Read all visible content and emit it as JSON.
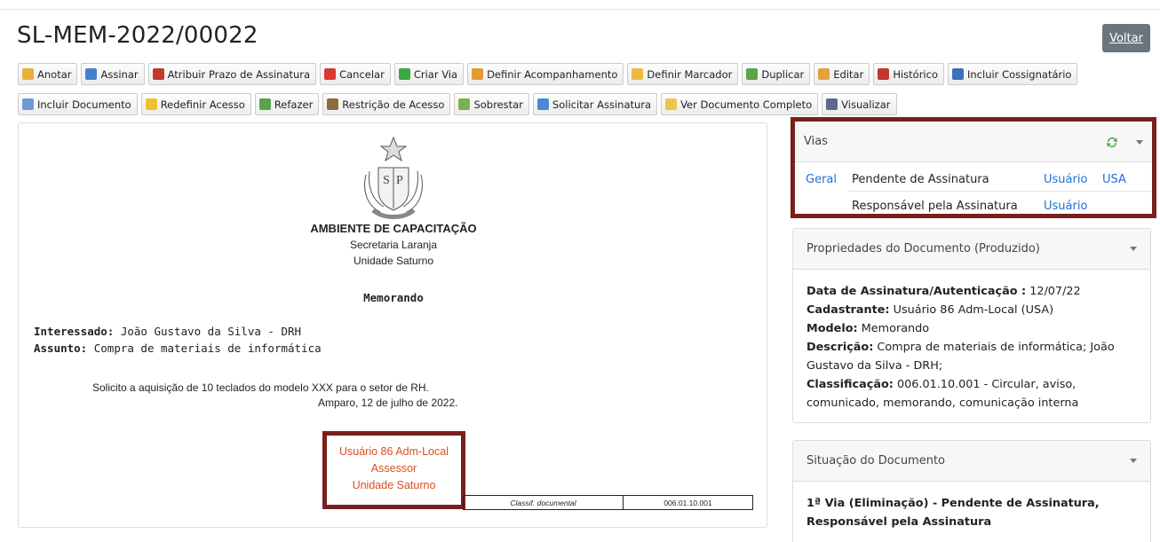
{
  "page": {
    "title": "SL-MEM-2022/00022",
    "back_label": "Voltar"
  },
  "toolbar1": [
    {
      "label": "Anotar",
      "icon": "annotate-icon",
      "color": "#e7b23a"
    },
    {
      "label": "Assinar",
      "icon": "sign-icon",
      "color": "#4a7fd0"
    },
    {
      "label": "Atribuir Prazo de Assinatura",
      "icon": "calendar-icon",
      "color": "#c0392b"
    },
    {
      "label": "Cancelar",
      "icon": "cancel-icon",
      "color": "#d93a2f"
    },
    {
      "label": "Criar Via",
      "icon": "add-icon",
      "color": "#3aa845"
    },
    {
      "label": "Definir Acompanhamento",
      "icon": "user-folder-icon",
      "color": "#e39a2e"
    },
    {
      "label": "Definir Marcador",
      "icon": "folder-icon",
      "color": "#efb93f"
    },
    {
      "label": "Duplicar",
      "icon": "duplicate-icon",
      "color": "#5aa34a"
    },
    {
      "label": "Editar",
      "icon": "pencil-icon",
      "color": "#e1a33c"
    },
    {
      "label": "Histórico",
      "icon": "history-icon",
      "color": "#c0392b"
    },
    {
      "label": "Incluir Cossignatário",
      "icon": "users-icon",
      "color": "#3e70b8"
    }
  ],
  "toolbar2": [
    {
      "label": "Incluir Documento",
      "icon": "document-add-icon",
      "color": "#6c9ad6"
    },
    {
      "label": "Redefinir Acesso",
      "icon": "shield-icon",
      "color": "#f0c030"
    },
    {
      "label": "Refazer",
      "icon": "redo-icon",
      "color": "#5aa34a"
    },
    {
      "label": "Restrição de Acesso",
      "icon": "lock-users-icon",
      "color": "#8a6d3b"
    },
    {
      "label": "Sobrestar",
      "icon": "stack-icon",
      "color": "#7fb04f"
    },
    {
      "label": "Solicitar Assinatura",
      "icon": "request-sign-icon",
      "color": "#4a8ad0"
    },
    {
      "label": "Ver Documento Completo",
      "icon": "folder-open-icon",
      "color": "#f0c44a"
    },
    {
      "label": "Visualizar",
      "icon": "eye-icon",
      "color": "#5a6b8c"
    }
  ],
  "document": {
    "org": "AMBIENTE DE CAPACITAÇÃO",
    "secretaria": "Secretaria Laranja",
    "unidade": "Unidade Saturno",
    "type": "Memorando",
    "interessado_label": "Interessado:",
    "interessado": "João Gustavo da Silva - DRH",
    "assunto_label": "Assunto:",
    "assunto": "Compra de materiais de informática",
    "body": "Solicito a aquisição de 10 teclados do modelo XXX para o setor de RH.",
    "date": "Amparo, 12 de julho de 2022.",
    "signer_name": "Usuário 86 Adm-Local",
    "signer_role": "Assessor",
    "signer_unit": "Unidade Saturno",
    "classif_label": "Classif. documental",
    "classif_value": "006.01.10.001"
  },
  "vias": {
    "title": "Vias",
    "rows": [
      {
        "via": "Geral",
        "status": "Pendente de Assinatura",
        "who": "Usuário",
        "org": "USA"
      },
      {
        "via": "",
        "status": "Responsável pela Assinatura",
        "who": "Usuário",
        "org": ""
      }
    ]
  },
  "propriedades": {
    "title": "Propriedades do Documento (Produzido)",
    "data_label": "Data de Assinatura/Autenticação :",
    "data_value": "12/07/22",
    "cadastrante_label": "Cadastrante:",
    "cadastrante_value": "Usuário 86 Adm-Local (USA)",
    "modelo_label": "Modelo:",
    "modelo_value": "Memorando",
    "descricao_label": "Descrição:",
    "descricao_value": "Compra de materiais de informática; João Gustavo da Silva - DRH;",
    "classificacao_label": "Classificação:",
    "classificacao_value": "006.01.10.001 - Circular, aviso, comunicado, memorando, comunicação interna"
  },
  "situacao": {
    "title": "Situação do Documento",
    "status": "1ª Via (Eliminação) - Pendente de Assinatura, Responsável pela Assinatura"
  }
}
